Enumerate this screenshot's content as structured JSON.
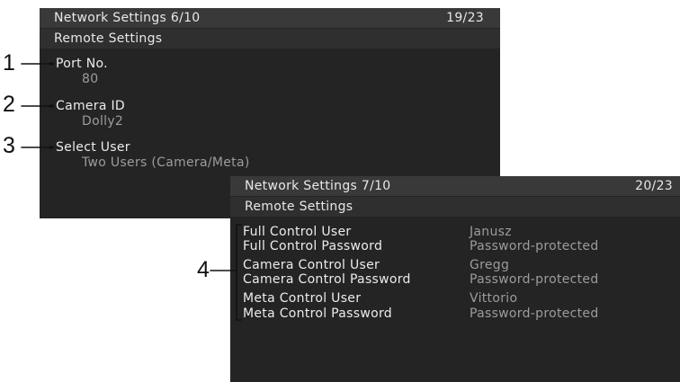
{
  "screen1": {
    "title": "Network Settings 6/10",
    "page": "19/23",
    "section": "Remote Settings",
    "items": [
      {
        "label": "Port No.",
        "value": "80"
      },
      {
        "label": "Camera ID",
        "value": "Dolly2"
      },
      {
        "label": "Select User",
        "value": "Two Users (Camera/Meta)"
      }
    ]
  },
  "screen2": {
    "title": "Network Settings 7/10",
    "page": "20/23",
    "section": "Remote Settings",
    "rows": [
      {
        "label": "Full Control User",
        "value": "Janusz"
      },
      {
        "label": "Full Control Password",
        "value": "Password-protected"
      },
      {
        "label": "Camera Control User",
        "value": "Gregg"
      },
      {
        "label": "Camera Control Password",
        "value": "Password-protected"
      },
      {
        "label": "Meta Control User",
        "value": "Vittorio"
      },
      {
        "label": "Meta Control Password",
        "value": "Password-protected"
      }
    ]
  },
  "callouts": {
    "c1": "1",
    "c2": "2",
    "c3": "3",
    "c4": "4"
  },
  "colors": {
    "screen_bg": "#242424",
    "header_bg": "#393939",
    "label": "#ececec",
    "value": "#9c9c9c",
    "callout": "#111111"
  }
}
